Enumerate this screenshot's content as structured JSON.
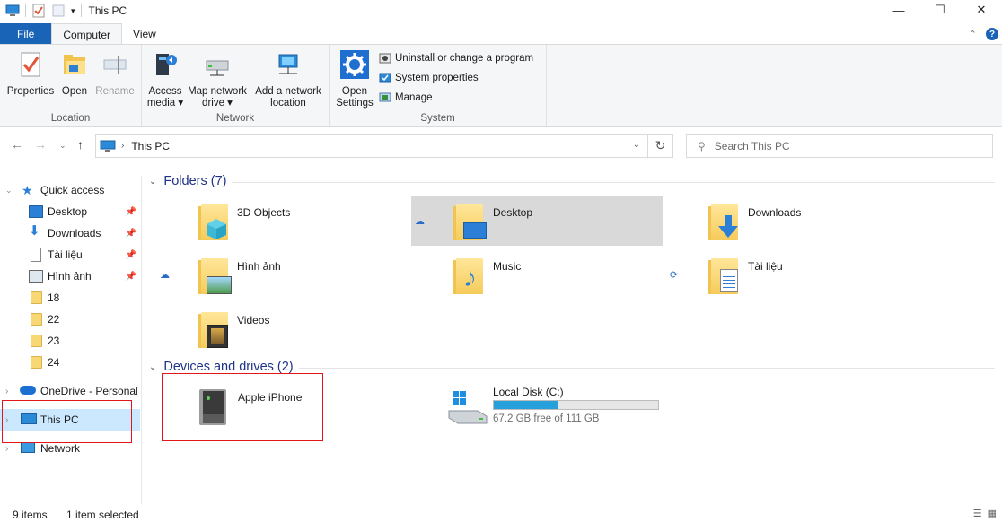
{
  "window": {
    "title": "This PC",
    "controls": {
      "minimize": "—",
      "maximize": "☐",
      "close": "✕"
    }
  },
  "ribbon_tabs": [
    "File",
    "Computer",
    "View"
  ],
  "ribbon": {
    "location": {
      "label": "Location",
      "buttons": [
        "Properties",
        "Open",
        "Rename"
      ]
    },
    "network": {
      "label": "Network",
      "access_media": [
        "Access",
        "media ▾"
      ],
      "map_network": [
        "Map network",
        "drive ▾"
      ],
      "add_network": [
        "Add a network",
        "location"
      ]
    },
    "system": {
      "label": "System",
      "open_settings": [
        "Open",
        "Settings"
      ],
      "small": [
        "Uninstall or change a program",
        "System properties",
        "Manage"
      ]
    }
  },
  "address": {
    "crumb": "This PC",
    "search_placeholder": "Search This PC"
  },
  "sidebar": {
    "quick_access": "Quick access",
    "pinned": [
      "Desktop",
      "Downloads",
      "Tài liệu",
      "Hình ảnh"
    ],
    "folders": [
      "18",
      "22",
      "23",
      "24"
    ],
    "onedrive": "OneDrive - Personal",
    "this_pc": "This PC",
    "network": "Network"
  },
  "main": {
    "folders_header": "Folders (7)",
    "folders": [
      "3D Objects",
      "Desktop",
      "Downloads",
      "Hình ảnh",
      "Music",
      "Tài liệu",
      "Videos"
    ],
    "devices_header": "Devices and drives (2)",
    "devices": {
      "iphone": "Apple iPhone",
      "local_disk": "Local Disk (C:)",
      "local_disk_free": "67.2 GB free of 111 GB",
      "local_disk_used_fraction": 0.395
    }
  },
  "status": {
    "items": "9 items",
    "selected": "1 item selected"
  },
  "colors": {
    "accent": "#1a64b8",
    "selection": "#cce8ff",
    "highlight": "#d9d9d9",
    "drive_fill": "#26a0da",
    "annotation_red": "#e0161b"
  }
}
